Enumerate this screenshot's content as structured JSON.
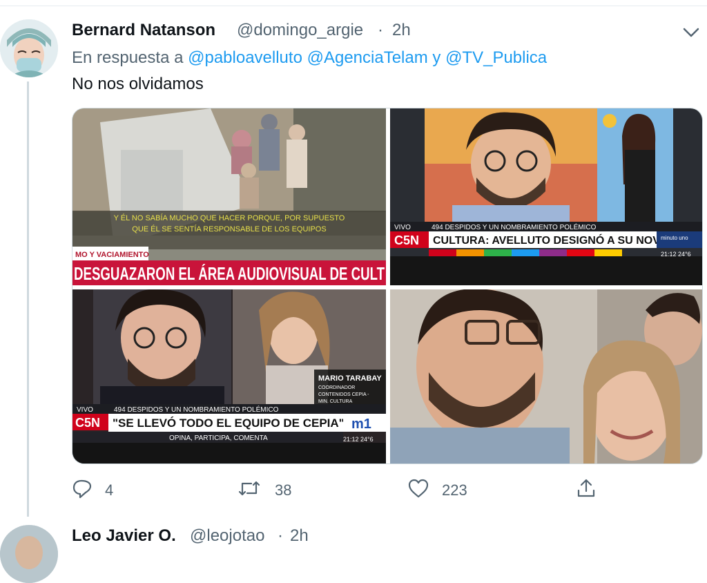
{
  "tweet": {
    "author_name": "Bernard Natanson",
    "author_handle": "@domingo_argie",
    "separator": "·",
    "time": "2h",
    "reply_prefix": "En respuesta a",
    "reply_mention_1": "@pabloavelluto",
    "reply_mention_2": "@AgenciaTelam",
    "reply_and": "y",
    "reply_mention_3": "@TV_Publica",
    "text": "No nos olvidamos"
  },
  "media": {
    "image1": {
      "subtitle_line1": "Y ÉL NO SABÍA MUCHO QUE HACER PORQUE, POR SUPUESTO",
      "subtitle_line2": "QUE ÉL SE SENTÍA RESPONSABLE DE LOS EQUIPOS",
      "tag": "MO Y VACIAMIENTO",
      "headline": "DESGUAZARON EL ÁREA AUDIOVISUAL DE CULT"
    },
    "image2": {
      "live_label": "VIVO",
      "topline": "494 DESPIDOS Y UN NOMBRAMIENTO POLÉMICO",
      "channel": "C5N",
      "headline": "CULTURA: AVELLUTO DESIGNÓ A SU NOVIA",
      "corner": "minuto uno",
      "clock": "21:12 24°6"
    },
    "image3": {
      "name_tag": "MARIO TARABAY",
      "role_line1": "COORDINADOR",
      "role_line2": "CONTENIDOS CEPIA -",
      "role_line3": "MIN. CULTURA",
      "live_label": "VIVO",
      "topline": "494 DESPIDOS Y UN NOMBRAMIENTO POLÉMICO",
      "channel": "C5N",
      "headline": "\"SE LLEVÓ TODO EL EQUIPO DE CEPIA\"",
      "footer": "OPINA, PARTICIPA, COMENTA",
      "logo": "m1",
      "clock": "21:12 24°6"
    }
  },
  "actions": {
    "reply_count": "4",
    "retweet_count": "38",
    "like_count": "223"
  },
  "next_tweet": {
    "author_name": "Leo Javier O.",
    "author_handle": "@leojotao",
    "separator": "·",
    "time": "2h"
  },
  "icons": [
    "chevron-down-icon",
    "reply-icon",
    "retweet-icon",
    "like-icon",
    "share-icon"
  ],
  "colors": {
    "link": "#1d9bf0",
    "muted": "#536471",
    "text": "#0f1419",
    "c5n_red": "#d0021b"
  }
}
